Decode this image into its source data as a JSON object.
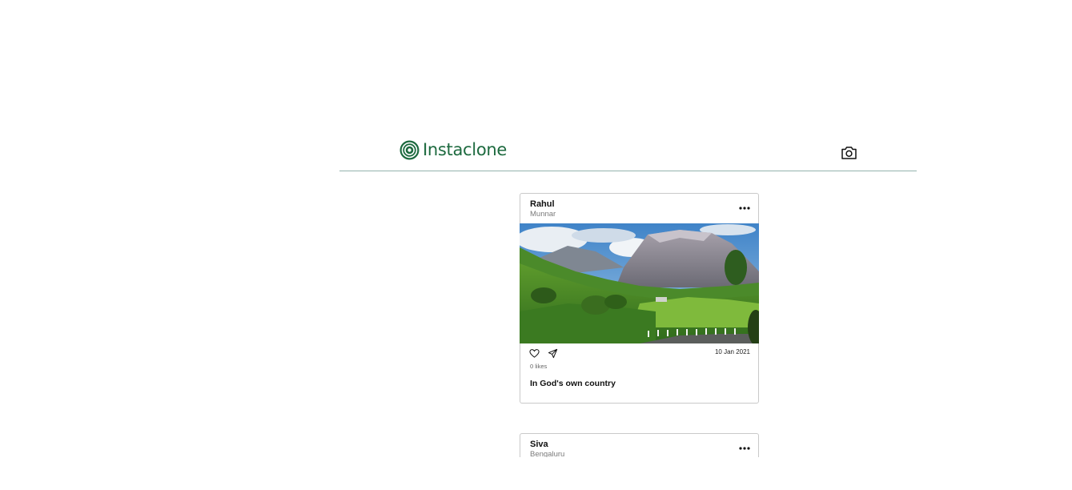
{
  "header": {
    "app_name": "Instaclone",
    "logo_icon": "concentric-circles-logo-icon",
    "camera_icon": "camera-icon",
    "brand_color": "#1d6a3f",
    "divider_color": "#93b3ad"
  },
  "posts": [
    {
      "user": "Rahul",
      "location": "Munnar",
      "more_icon": "more-options-icon",
      "image_desc_icon": "landscape-photo",
      "like_icon": "heart-icon",
      "share_icon": "send-icon",
      "date": "10 Jan 2021",
      "likes": "0 likes",
      "caption": "In God's own country"
    },
    {
      "user": "Siva",
      "location": "Bengaluru",
      "more_icon": "more-options-icon"
    }
  ]
}
